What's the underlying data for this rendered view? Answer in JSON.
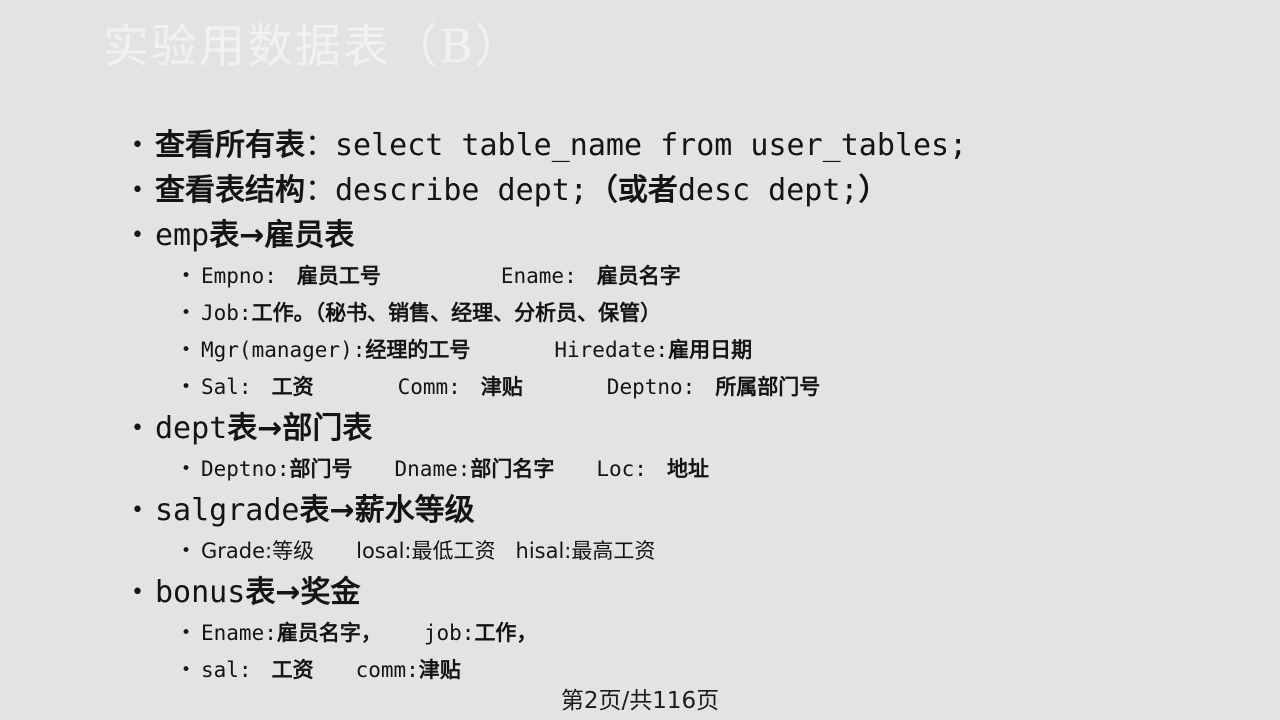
{
  "slide": {
    "title": "实验用数据表（B）",
    "title_color": "#f2f1f1",
    "background_color": "#e4e3e3",
    "text_color": "#141414"
  },
  "bullets": {
    "marker": "•",
    "arrow": "→"
  },
  "content": [
    {
      "level": 1,
      "name": "view-all-tables",
      "label_cjk": "查看所有表",
      "label_sep": "：",
      "code": "select table_name from user_tables;"
    },
    {
      "level": 1,
      "name": "view-table-structure",
      "label_cjk": "查看表结构",
      "label_sep": "：",
      "code_a": "describe dept;",
      "paren_open": "（",
      "alt_cjk": "或者",
      "code_b": "desc dept;",
      "paren_close": "）"
    },
    {
      "level": 1,
      "name": "emp-table",
      "table": "emp",
      "suffix_cjk": "表",
      "arrow": "→",
      "meaning_cjk": "雇员表"
    },
    {
      "level": 2,
      "name": "emp-empno-ename",
      "col1_code": "Empno:",
      "col1_cjk": "雇员工号",
      "col2_code": "Ename:",
      "col2_cjk": "雇员名字"
    },
    {
      "level": 2,
      "name": "emp-job",
      "col1_code": "Job:",
      "col1_cjk": "工作。",
      "col1_detail": "（秘书、销售、经理、分析员、保管）"
    },
    {
      "level": 2,
      "name": "emp-mgr-hiredate",
      "col1_code": "Mgr(manager):",
      "col1_cjk": "经理的工号",
      "col2_code": "Hiredate:",
      "col2_cjk": "雇用日期"
    },
    {
      "level": 2,
      "name": "emp-sal-comm-deptno",
      "col1_code": "Sal:",
      "col1_cjk": "工资",
      "col2_code": "Comm:",
      "col2_cjk": "津贴",
      "col3_code": "Deptno:",
      "col3_cjk": "所属部门号"
    },
    {
      "level": 1,
      "name": "dept-table",
      "table": "dept",
      "suffix_cjk": "表",
      "arrow": "→",
      "meaning_cjk": "部门表"
    },
    {
      "level": 2,
      "name": "dept-columns",
      "col1_code": "Deptno:",
      "col1_cjk": "部门号",
      "col2_code": "Dname:",
      "col2_cjk": "部门名字",
      "col3_code": "Loc:",
      "col3_cjk": "地址"
    },
    {
      "level": 1,
      "name": "salgrade-table",
      "table": "salgrade",
      "suffix_cjk": "表",
      "arrow": "→",
      "meaning_cjk": "薪水等级"
    },
    {
      "level": 2,
      "name": "salgrade-columns",
      "col1_code": "Grade:",
      "col1_cjk": "等级",
      "col2_code": "losal:",
      "col2_cjk": "最低工资",
      "col3_code": "hisal:",
      "col3_cjk": "最高工资"
    },
    {
      "level": 1,
      "name": "bonus-table",
      "table": "bonus",
      "suffix_cjk": "表",
      "arrow": "→",
      "meaning_cjk": "奖金"
    },
    {
      "level": 2,
      "name": "bonus-ename-job",
      "col1_code": "Ename:",
      "col1_cjk": "雇员名字，",
      "col2_code": "job:",
      "col2_cjk": "工作，"
    },
    {
      "level": 2,
      "name": "bonus-sal-comm",
      "col1_code": "sal:",
      "col1_cjk": "工资",
      "col2_code": "comm:",
      "col2_cjk": "津贴"
    }
  ],
  "footer": {
    "text": "第2页/共116页"
  }
}
